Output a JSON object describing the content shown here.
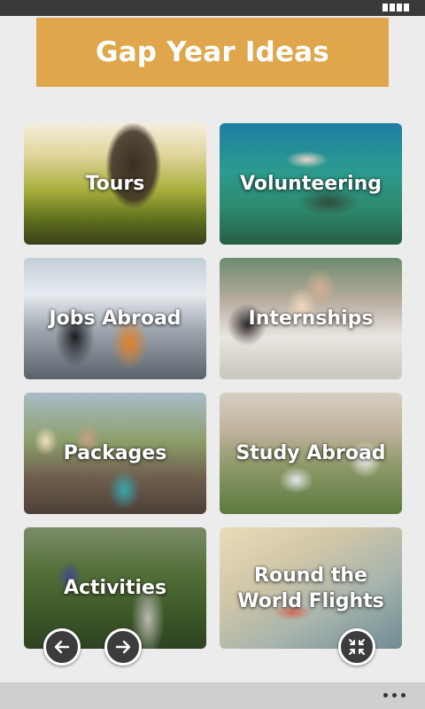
{
  "header": {
    "title": "Gap Year Ideas"
  },
  "colors": {
    "banner": "#dfa64b",
    "status_bar": "#3a3a3a",
    "bottom_bar": "#cfcfcf"
  },
  "tiles": [
    {
      "label": "Tours"
    },
    {
      "label": "Volunteering"
    },
    {
      "label": "Jobs Abroad"
    },
    {
      "label": "Internships"
    },
    {
      "label": "Packages"
    },
    {
      "label": "Study Abroad"
    },
    {
      "label": "Activities"
    },
    {
      "label": "Round the World Flights"
    }
  ],
  "controls": {
    "prev_icon": "arrow-left-icon",
    "next_icon": "arrow-right-icon",
    "collapse_icon": "fullscreen-exit-icon",
    "menu_icon": "more-horizontal-icon"
  }
}
